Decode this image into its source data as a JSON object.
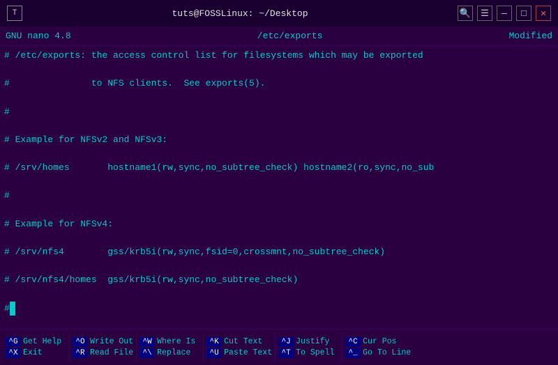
{
  "titlebar": {
    "icon": "T",
    "title": "tuts@FOSSLinux: ~/Desktop",
    "search_icon": "🔍",
    "menu_icon": "☰",
    "minimize_icon": "—",
    "maximize_icon": "□",
    "close_icon": "✕"
  },
  "nano": {
    "version": "GNU nano 4.8",
    "filename": "/etc/exports",
    "status": "Modified"
  },
  "editor": {
    "lines": [
      "# /etc/exports: the access control list for filesystems which may be exported",
      "#               to NFS clients.  See exports(5).",
      "#",
      "# Example for NFSv2 and NFSv3:",
      "# /srv/homes       hostname1(rw,sync,no_subtree_check) hostname2(ro,sync,no_sub",
      "#",
      "# Example for NFSv4:",
      "# /srv/nfs4        gss/krb5i(rw,sync,fsid=0,crossmnt,no_subtree_check)",
      "# /srv/nfs4/homes  gss/krb5i(rw,sync,no_subtree_check)",
      "#"
    ],
    "cursor_line": 9,
    "cursor_char": 1
  },
  "shortcuts": [
    {
      "rows": [
        {
          "key": "^G",
          "label": "Get Help"
        },
        {
          "key": "^X",
          "label": "Exit"
        }
      ]
    },
    {
      "rows": [
        {
          "key": "^O",
          "label": "Write Out"
        },
        {
          "key": "^R",
          "label": "Read File"
        }
      ]
    },
    {
      "rows": [
        {
          "key": "^W",
          "label": "Where Is"
        },
        {
          "key": "^\\",
          "label": "Replace"
        }
      ]
    },
    {
      "rows": [
        {
          "key": "^K",
          "label": "Cut Text"
        },
        {
          "key": "^U",
          "label": "Paste Text"
        }
      ]
    },
    {
      "rows": [
        {
          "key": "^J",
          "label": "Justify"
        },
        {
          "key": "^T",
          "label": "To Spell"
        }
      ]
    },
    {
      "rows": [
        {
          "key": "^C",
          "label": "Cur Pos"
        },
        {
          "key": "^_",
          "label": "Go To Line"
        }
      ]
    }
  ]
}
